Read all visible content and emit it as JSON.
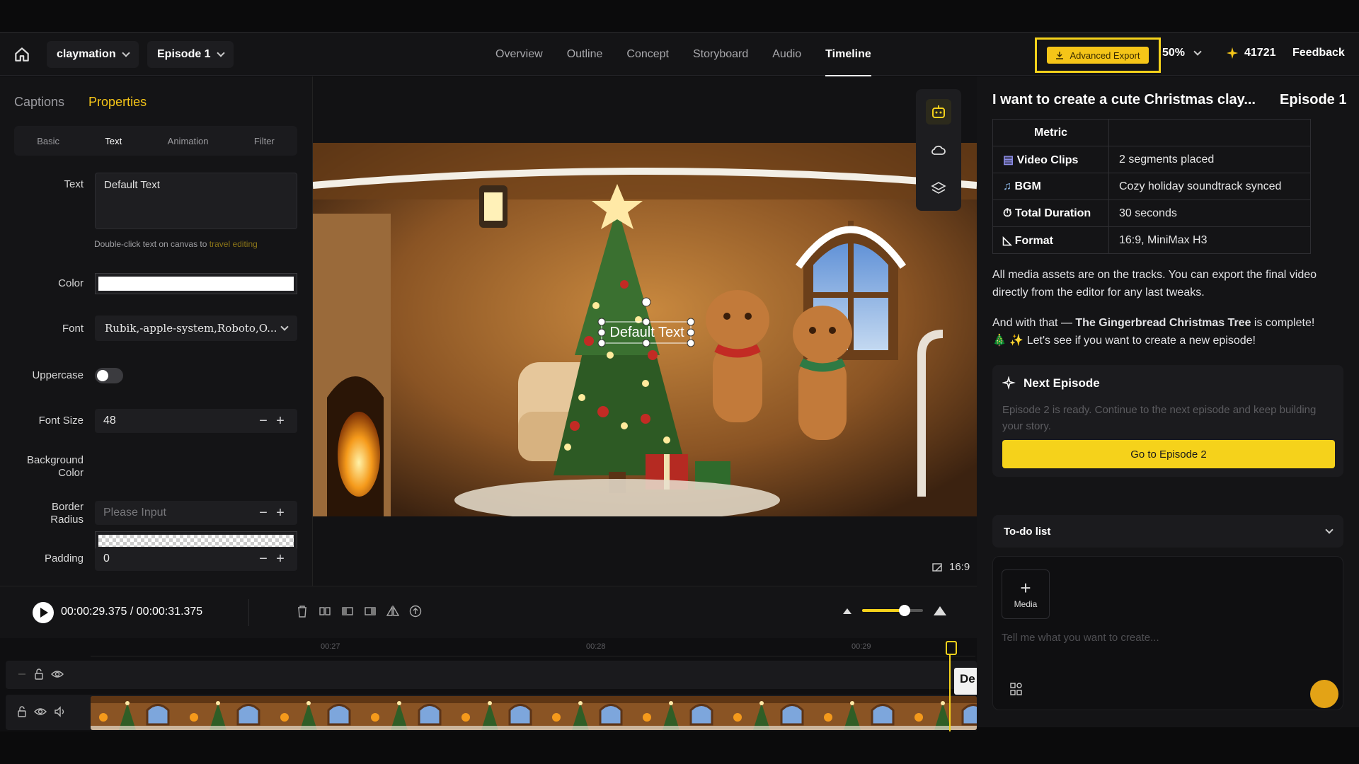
{
  "topbar": {
    "project": "claymation",
    "episode": "Episode 1",
    "nav": [
      "Overview",
      "Outline",
      "Concept",
      "Storyboard",
      "Audio",
      "Timeline"
    ],
    "active_nav": "Timeline",
    "export_label": "Advanced Export",
    "zoom": "50%",
    "credits": "41721",
    "feedback": "Feedback"
  },
  "left": {
    "tabs": [
      "Captions",
      "Properties"
    ],
    "active_tab": "Properties",
    "subtabs": [
      "Basic",
      "Text",
      "Animation",
      "Filter"
    ],
    "active_subtab": "Text",
    "text_label": "Text",
    "text_value": "Default Text",
    "hint": "Double-click text on canvas to",
    "hint_link": "travel editing",
    "color_label": "Color",
    "color_value": "#ffffff",
    "font_label": "Font",
    "font_value": "Rubik,-apple-system,Roboto,O...",
    "uppercase_label": "Uppercase",
    "uppercase_on": false,
    "fontsize_label": "Font Size",
    "fontsize_value": "48",
    "bg_label_1": "Background",
    "bg_label_2": "Color",
    "radius_label_1": "Border",
    "radius_label_2": "Radius",
    "radius_placeholder": "Please Input",
    "padding_label": "Padding",
    "padding_value": "0"
  },
  "canvas": {
    "overlay_text": "Default Text",
    "aspect": "16:9"
  },
  "transport": {
    "current": "00:00:29.375",
    "separator": "/",
    "total": "00:00:31.375",
    "zoom_level": 0.7
  },
  "timeline": {
    "ticks": [
      "00:27",
      "00:28",
      "00:29"
    ],
    "text_clip": "De"
  },
  "right": {
    "title": "I want to create a cute Christmas clay...",
    "episode": "Episode 1",
    "table_header": "Metric",
    "rows": [
      {
        "icon": "video-icon",
        "key": "Video Clips",
        "value": "2 segments placed"
      },
      {
        "icon": "music-icon",
        "key": "BGM",
        "value": "Cozy holiday soundtrack synced"
      },
      {
        "icon": "timer-icon",
        "key": "Total Duration",
        "value": "30 seconds"
      },
      {
        "icon": "ruler-icon",
        "key": "Format",
        "value": "16:9, MiniMax H3"
      }
    ],
    "msg1": "All media assets are on the tracks. You can export the final video directly from the editor for any last tweaks.",
    "msg2_pre": "And with that — ",
    "msg2_bold": "The Gingerbread Christmas Tree",
    "msg2_post": " is complete!",
    "msg3": "🎄 ✨ Let's see if you want to create a new episode!",
    "next_title": "Next Episode",
    "next_desc": "Episode 2 is ready. Continue to the next episode and keep building your story.",
    "next_button": "Go to Episode 2",
    "todo": "To-do list",
    "media": "Media",
    "prompt_placeholder": "Tell me what you want to create..."
  },
  "colors": {
    "accent": "#f5d21b",
    "bg": "#141416"
  }
}
